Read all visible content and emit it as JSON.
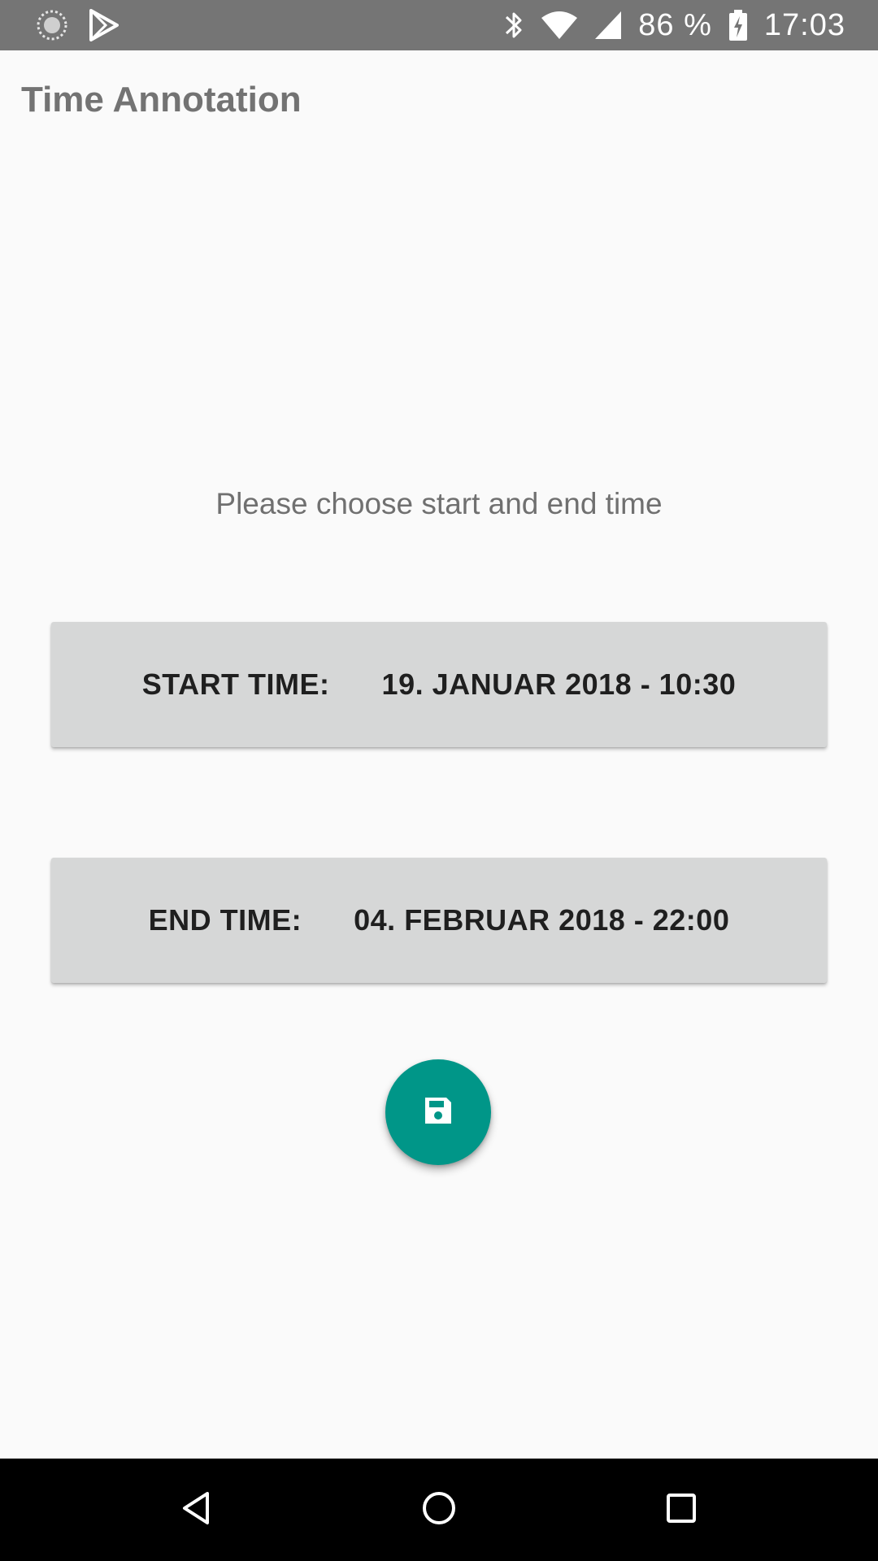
{
  "status_bar": {
    "left_icons": [
      "loading-circle-icon",
      "play-store-icon"
    ],
    "right_icons": [
      "bluetooth-icon",
      "wifi-icon",
      "cell-signal-icon",
      "battery-charging-icon"
    ],
    "battery_percent": "86 %",
    "time": "17:03"
  },
  "app": {
    "title": "Time Annotation"
  },
  "main": {
    "instruction": "Please choose start and end time",
    "start": {
      "label": "START TIME:",
      "value": "19. JANUAR 2018 - 10:30"
    },
    "end": {
      "label": "END TIME:",
      "value": "04. FEBRUAR 2018 - 22:00"
    },
    "save_fab_icon": "floppy-disk-save-icon"
  },
  "navigation": {
    "buttons": [
      "back-icon",
      "home-icon",
      "recents-icon"
    ]
  },
  "colors": {
    "status_bar": "#757575",
    "background": "#fafafa",
    "button_bg": "#d6d7d7",
    "fab": "#009688",
    "nav_bar": "#000000"
  }
}
